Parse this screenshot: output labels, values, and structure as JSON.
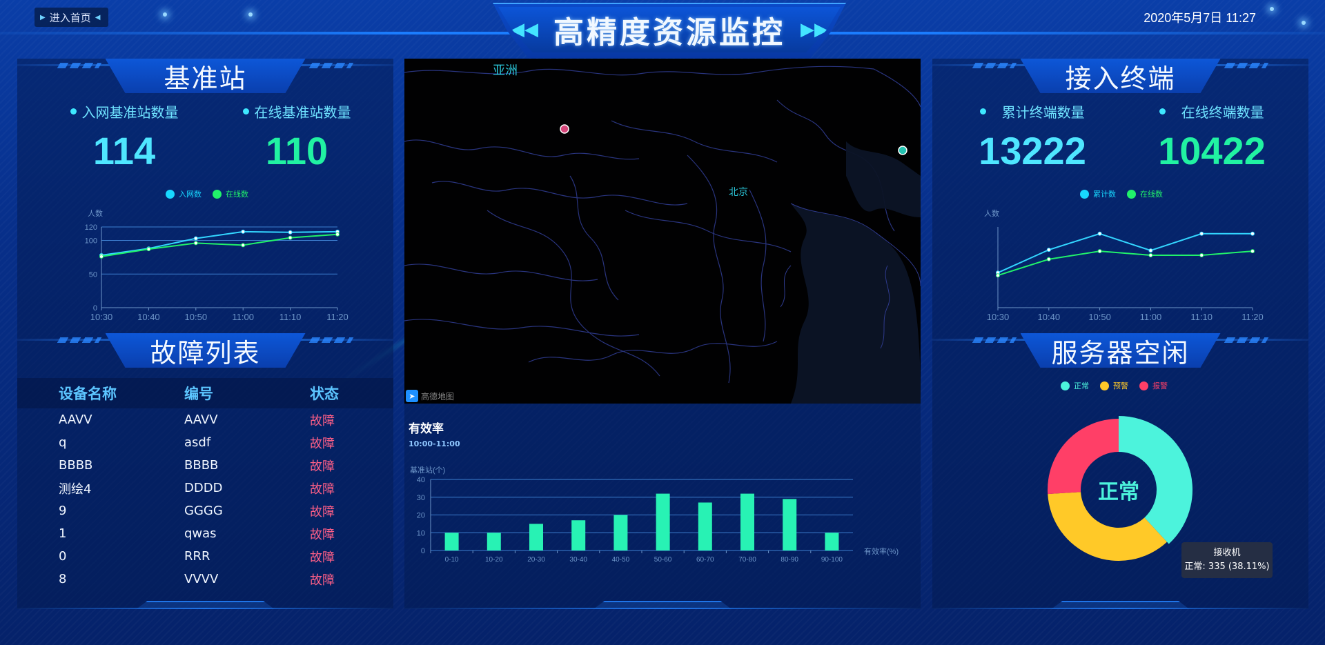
{
  "header": {
    "home_button": "进入首页",
    "title": "高精度资源监控",
    "datetime": "2020年5月7日 11:27"
  },
  "base_station": {
    "title": "基准站",
    "stats": [
      {
        "label": "入网基准站数量",
        "value": "114"
      },
      {
        "label": "在线基准站数量",
        "value": "110"
      }
    ],
    "legend": [
      "入网数",
      "在线数"
    ],
    "ylabel": "人数"
  },
  "fault_list": {
    "title": "故障列表",
    "columns": [
      "设备名称",
      "编号",
      "状态"
    ],
    "rows": [
      {
        "name": "AAVV",
        "code": "AAVV",
        "status": "故障"
      },
      {
        "name": "q",
        "code": "asdf",
        "status": "故障"
      },
      {
        "name": "BBBB",
        "code": "BBBB",
        "status": "故障"
      },
      {
        "name": "测绘4",
        "code": "DDDD",
        "status": "故障"
      },
      {
        "name": "9",
        "code": "GGGG",
        "status": "故障"
      },
      {
        "name": "1",
        "code": "qwas",
        "status": "故障"
      },
      {
        "name": "0",
        "code": "RRR",
        "status": "故障"
      },
      {
        "name": "8",
        "code": "VVVV",
        "status": "故障"
      }
    ]
  },
  "map": {
    "labels": {
      "asia": "亚洲",
      "beijing": "北京"
    },
    "watermark": "高德地图"
  },
  "efficiency": {
    "title": "有效率",
    "subtitle": "10:00-11:00"
  },
  "terminals": {
    "title": "接入终端",
    "stats": [
      {
        "label": "累计终端数量",
        "value": "13222"
      },
      {
        "label": "在线终端数量",
        "value": "10422"
      }
    ],
    "legend": [
      "累计数",
      "在线数"
    ],
    "ylabel": "人数"
  },
  "server": {
    "title": "服务器空闲",
    "legend": [
      "正常",
      "预警",
      "报警"
    ],
    "center_label": "正常",
    "tooltip_title": "接收机",
    "tooltip_value": "正常: 335 (38.11%)"
  },
  "colors": {
    "cyan": "#3ee8ff",
    "green": "#21f26a",
    "normal": "#4cf3dc",
    "warning": "#ffc928",
    "alarm": "#ff3f67",
    "bar": "#28f2b4",
    "fault": "#ff5f87"
  },
  "chart_data": [
    {
      "id": "base-station-line",
      "type": "line",
      "x": [
        "10:30",
        "10:40",
        "10:50",
        "11:00",
        "11:10",
        "11:20"
      ],
      "ylabel": "人数",
      "yticks": [
        0,
        50,
        100,
        120
      ],
      "ylim": [
        0,
        120
      ],
      "series": [
        {
          "name": "入网数",
          "values": [
            78,
            88,
            103,
            113,
            112,
            113
          ]
        },
        {
          "name": "在线数",
          "values": [
            76,
            87,
            96,
            93,
            104,
            109
          ]
        }
      ],
      "legend": "top-center"
    },
    {
      "id": "efficiency-bar",
      "type": "bar",
      "categories": [
        "0-10",
        "10-20",
        "20-30",
        "30-40",
        "40-50",
        "50-60",
        "60-70",
        "70-80",
        "80-90",
        "90-100"
      ],
      "values": [
        10,
        10,
        15,
        17,
        20,
        32,
        27,
        32,
        29,
        10
      ],
      "ylabel": "基准站(个)",
      "xlabel": "有效率(%)",
      "yticks": [
        0,
        10,
        20,
        30,
        40
      ],
      "ylim": [
        0,
        40
      ]
    },
    {
      "id": "terminals-line",
      "type": "line",
      "x": [
        "10:30",
        "10:40",
        "10:50",
        "11:00",
        "11:10",
        "11:20"
      ],
      "ylabel": "人数",
      "ylim": [
        0,
        120
      ],
      "series": [
        {
          "name": "累计数",
          "values": [
            52,
            86,
            110,
            85,
            110,
            110
          ]
        },
        {
          "name": "在线数",
          "values": [
            48,
            72,
            84,
            78,
            78,
            84
          ]
        }
      ],
      "legend": "top-center"
    },
    {
      "id": "server-donut",
      "type": "pie",
      "categories": [
        "正常",
        "预警",
        "报警"
      ],
      "values": [
        38.11,
        35.94,
        25.95
      ]
    }
  ]
}
